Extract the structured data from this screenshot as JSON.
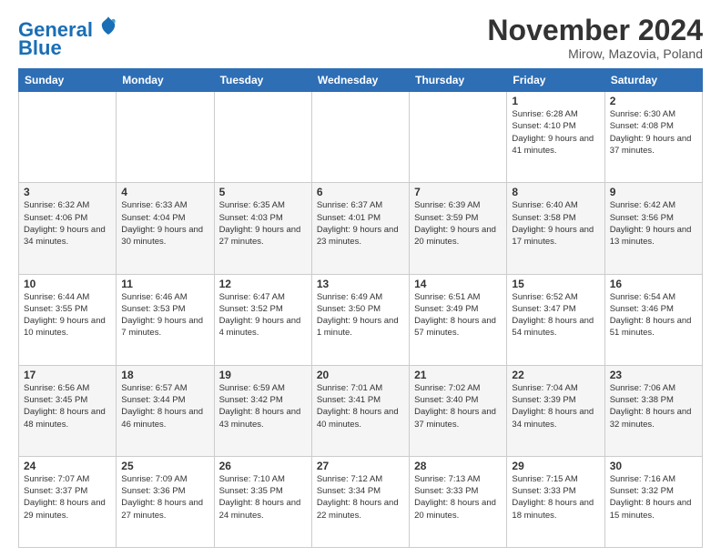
{
  "header": {
    "logo_text1": "General",
    "logo_text2": "Blue",
    "month": "November 2024",
    "location": "Mirow, Mazovia, Poland"
  },
  "days_of_week": [
    "Sunday",
    "Monday",
    "Tuesday",
    "Wednesday",
    "Thursday",
    "Friday",
    "Saturday"
  ],
  "weeks": [
    [
      {
        "day": "",
        "info": ""
      },
      {
        "day": "",
        "info": ""
      },
      {
        "day": "",
        "info": ""
      },
      {
        "day": "",
        "info": ""
      },
      {
        "day": "",
        "info": ""
      },
      {
        "day": "1",
        "info": "Sunrise: 6:28 AM\nSunset: 4:10 PM\nDaylight: 9 hours and 41 minutes."
      },
      {
        "day": "2",
        "info": "Sunrise: 6:30 AM\nSunset: 4:08 PM\nDaylight: 9 hours and 37 minutes."
      }
    ],
    [
      {
        "day": "3",
        "info": "Sunrise: 6:32 AM\nSunset: 4:06 PM\nDaylight: 9 hours and 34 minutes."
      },
      {
        "day": "4",
        "info": "Sunrise: 6:33 AM\nSunset: 4:04 PM\nDaylight: 9 hours and 30 minutes."
      },
      {
        "day": "5",
        "info": "Sunrise: 6:35 AM\nSunset: 4:03 PM\nDaylight: 9 hours and 27 minutes."
      },
      {
        "day": "6",
        "info": "Sunrise: 6:37 AM\nSunset: 4:01 PM\nDaylight: 9 hours and 23 minutes."
      },
      {
        "day": "7",
        "info": "Sunrise: 6:39 AM\nSunset: 3:59 PM\nDaylight: 9 hours and 20 minutes."
      },
      {
        "day": "8",
        "info": "Sunrise: 6:40 AM\nSunset: 3:58 PM\nDaylight: 9 hours and 17 minutes."
      },
      {
        "day": "9",
        "info": "Sunrise: 6:42 AM\nSunset: 3:56 PM\nDaylight: 9 hours and 13 minutes."
      }
    ],
    [
      {
        "day": "10",
        "info": "Sunrise: 6:44 AM\nSunset: 3:55 PM\nDaylight: 9 hours and 10 minutes."
      },
      {
        "day": "11",
        "info": "Sunrise: 6:46 AM\nSunset: 3:53 PM\nDaylight: 9 hours and 7 minutes."
      },
      {
        "day": "12",
        "info": "Sunrise: 6:47 AM\nSunset: 3:52 PM\nDaylight: 9 hours and 4 minutes."
      },
      {
        "day": "13",
        "info": "Sunrise: 6:49 AM\nSunset: 3:50 PM\nDaylight: 9 hours and 1 minute."
      },
      {
        "day": "14",
        "info": "Sunrise: 6:51 AM\nSunset: 3:49 PM\nDaylight: 8 hours and 57 minutes."
      },
      {
        "day": "15",
        "info": "Sunrise: 6:52 AM\nSunset: 3:47 PM\nDaylight: 8 hours and 54 minutes."
      },
      {
        "day": "16",
        "info": "Sunrise: 6:54 AM\nSunset: 3:46 PM\nDaylight: 8 hours and 51 minutes."
      }
    ],
    [
      {
        "day": "17",
        "info": "Sunrise: 6:56 AM\nSunset: 3:45 PM\nDaylight: 8 hours and 48 minutes."
      },
      {
        "day": "18",
        "info": "Sunrise: 6:57 AM\nSunset: 3:44 PM\nDaylight: 8 hours and 46 minutes."
      },
      {
        "day": "19",
        "info": "Sunrise: 6:59 AM\nSunset: 3:42 PM\nDaylight: 8 hours and 43 minutes."
      },
      {
        "day": "20",
        "info": "Sunrise: 7:01 AM\nSunset: 3:41 PM\nDaylight: 8 hours and 40 minutes."
      },
      {
        "day": "21",
        "info": "Sunrise: 7:02 AM\nSunset: 3:40 PM\nDaylight: 8 hours and 37 minutes."
      },
      {
        "day": "22",
        "info": "Sunrise: 7:04 AM\nSunset: 3:39 PM\nDaylight: 8 hours and 34 minutes."
      },
      {
        "day": "23",
        "info": "Sunrise: 7:06 AM\nSunset: 3:38 PM\nDaylight: 8 hours and 32 minutes."
      }
    ],
    [
      {
        "day": "24",
        "info": "Sunrise: 7:07 AM\nSunset: 3:37 PM\nDaylight: 8 hours and 29 minutes."
      },
      {
        "day": "25",
        "info": "Sunrise: 7:09 AM\nSunset: 3:36 PM\nDaylight: 8 hours and 27 minutes."
      },
      {
        "day": "26",
        "info": "Sunrise: 7:10 AM\nSunset: 3:35 PM\nDaylight: 8 hours and 24 minutes."
      },
      {
        "day": "27",
        "info": "Sunrise: 7:12 AM\nSunset: 3:34 PM\nDaylight: 8 hours and 22 minutes."
      },
      {
        "day": "28",
        "info": "Sunrise: 7:13 AM\nSunset: 3:33 PM\nDaylight: 8 hours and 20 minutes."
      },
      {
        "day": "29",
        "info": "Sunrise: 7:15 AM\nSunset: 3:33 PM\nDaylight: 8 hours and 18 minutes."
      },
      {
        "day": "30",
        "info": "Sunrise: 7:16 AM\nSunset: 3:32 PM\nDaylight: 8 hours and 15 minutes."
      }
    ]
  ]
}
